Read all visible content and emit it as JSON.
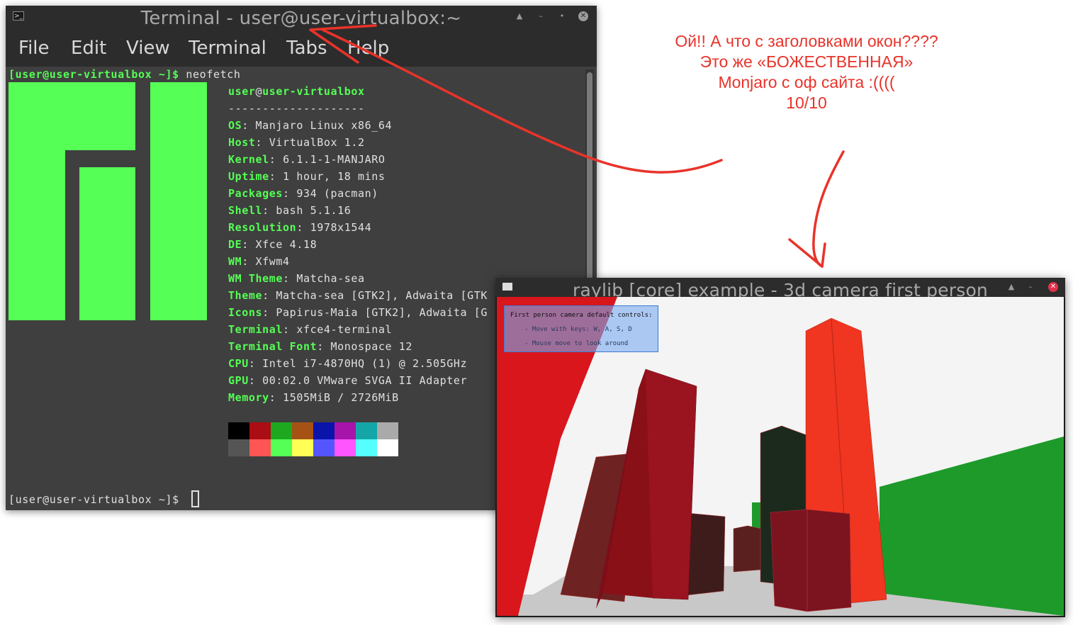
{
  "terminal": {
    "title": "Terminal - user@user-virtualbox:~",
    "menu": [
      "File",
      "Edit",
      "View",
      "Terminal",
      "Tabs",
      "Help"
    ],
    "prompt": "[user@user-virtualbox ~]$",
    "command": "neofetch",
    "user": "user",
    "at": "@",
    "host": "user-virtualbox",
    "separator": "--------------------",
    "info": [
      {
        "key": "OS",
        "value": "Manjaro Linux x86_64"
      },
      {
        "key": "Host",
        "value": "VirtualBox 1.2"
      },
      {
        "key": "Kernel",
        "value": "6.1.1-1-MANJARO"
      },
      {
        "key": "Uptime",
        "value": "1 hour, 18 mins"
      },
      {
        "key": "Packages",
        "value": "934 (pacman)"
      },
      {
        "key": "Shell",
        "value": "bash 5.1.16"
      },
      {
        "key": "Resolution",
        "value": "1978x1544"
      },
      {
        "key": "DE",
        "value": "Xfce 4.18"
      },
      {
        "key": "WM",
        "value": "Xfwm4"
      },
      {
        "key": "WM Theme",
        "value": "Matcha-sea"
      },
      {
        "key": "Theme",
        "value": "Matcha-sea [GTK2], Adwaita [GTK"
      },
      {
        "key": "Icons",
        "value": "Papirus-Maia [GTK2], Adwaita [G"
      },
      {
        "key": "Terminal",
        "value": "xfce4-terminal"
      },
      {
        "key": "Terminal Font",
        "value": "Monospace 12"
      },
      {
        "key": "CPU",
        "value": "Intel i7-4870HQ (1) @ 2.505GHz"
      },
      {
        "key": "GPU",
        "value": "00:02.0 VMware SVGA II Adapter"
      },
      {
        "key": "Memory",
        "value": "1505MiB / 2726MiB"
      }
    ],
    "palette_dark": [
      "#000000",
      "#aa0d14",
      "#1ea820",
      "#a65214",
      "#0b14aa",
      "#a614aa",
      "#14a6a6",
      "#aaaaaa"
    ],
    "palette_bright": [
      "#555555",
      "#ff5555",
      "#55ff55",
      "#ffff55",
      "#5555ff",
      "#ff55ff",
      "#55ffff",
      "#ffffff"
    ],
    "colors": {
      "accent": "#55ff55",
      "background": "#3f3f3f",
      "titlebar": "#2c2c2c"
    }
  },
  "raylib": {
    "title": "raylib [core] example - 3d camera first person",
    "controls": {
      "heading": "First person camera default controls:",
      "lines": [
        "- Move with keys: W, A, S, D",
        "- Mouse move to look around"
      ]
    }
  },
  "annotation": {
    "lines": [
      "Ой!! А что с заголовками окон????",
      "Это же «БОЖЕСТВЕННАЯ»",
      "Monjaro с оф сайта :((((",
      "10/10"
    ],
    "color": "#e8332a"
  }
}
